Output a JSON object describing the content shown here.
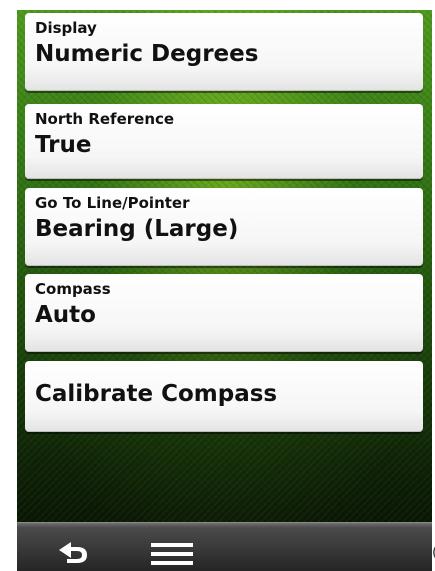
{
  "settings": {
    "items": [
      {
        "label": "Display",
        "value": "Numeric Degrees"
      },
      {
        "label": "North Reference",
        "value": "True"
      },
      {
        "label": "Go To Line/Pointer",
        "value": "Bearing (Large)"
      },
      {
        "label": "Compass",
        "value": "Auto"
      }
    ],
    "calibrate_label": "Calibrate Compass"
  },
  "toolbar": {
    "back_icon": "back-arrow-icon",
    "menu_icon": "hamburger-menu-icon"
  },
  "edge_fragment": "("
}
